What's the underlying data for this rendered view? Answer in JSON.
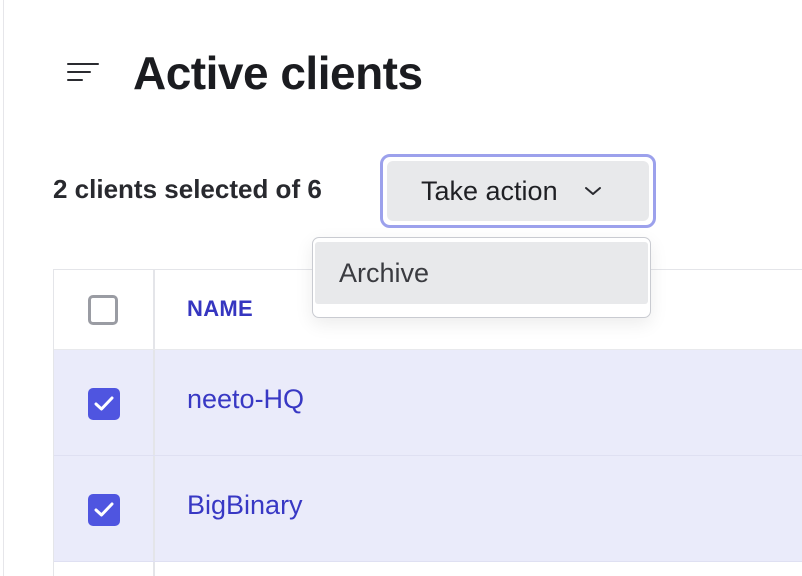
{
  "header": {
    "menu_icon": "hamburger-menu-icon",
    "title": "Active clients"
  },
  "toolbar": {
    "selection_text": "2 clients selected of 6",
    "take_action_label": "Take action",
    "chevron_icon": "chevron-down-icon"
  },
  "dropdown": {
    "items": [
      {
        "label": "Archive"
      }
    ]
  },
  "table": {
    "columns": [
      {
        "label": "NAME"
      }
    ],
    "rows": [
      {
        "name": "neeto-HQ",
        "selected": true
      },
      {
        "name": "BigBinary",
        "selected": true
      }
    ]
  },
  "colors": {
    "accent": "#4f55e0",
    "link": "#3838c4",
    "selected_row": "#eaebfa",
    "focus_ring": "#9ca1ec"
  }
}
